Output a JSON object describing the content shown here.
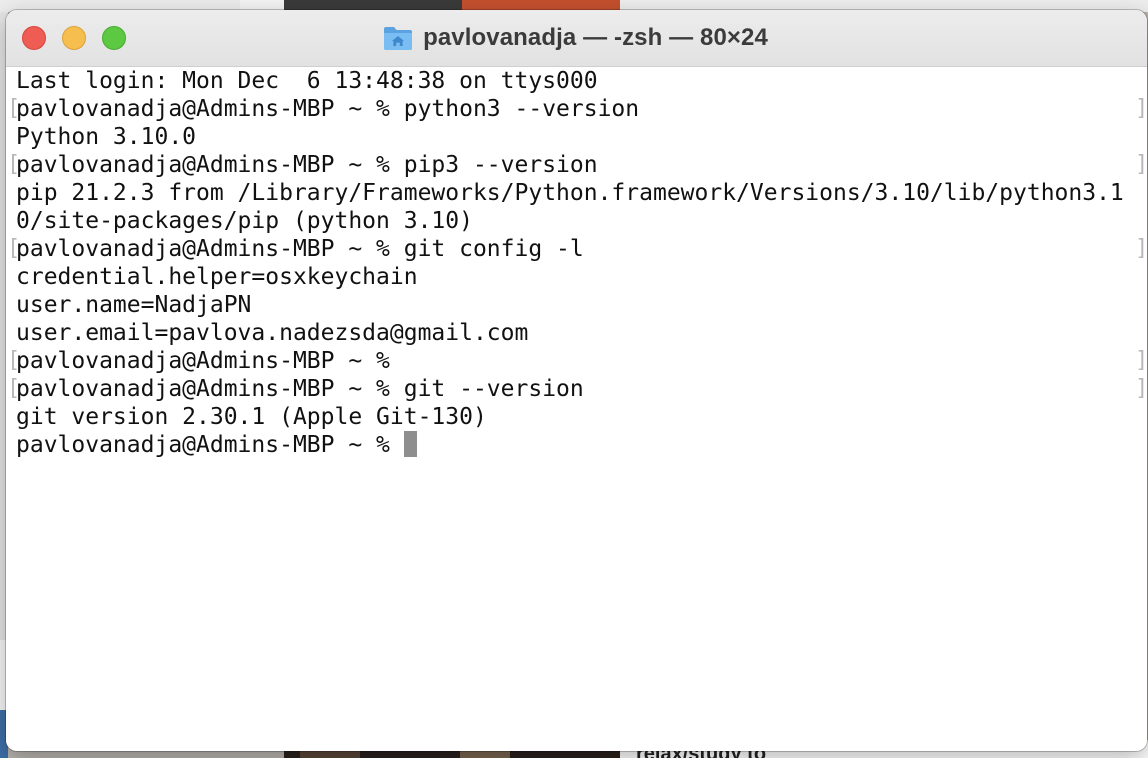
{
  "window": {
    "title": "pavlovanadja — -zsh — 80×24",
    "title_icon": "home-folder-icon"
  },
  "desktop": {
    "partial_text": "relax/study to"
  },
  "terminal": {
    "lines": [
      {
        "text": "Last login: Mon Dec  6 13:48:38 on ttys000",
        "marked": false
      },
      {
        "text": "pavlovanadja@Admins-MBP ~ % python3 --version",
        "marked": true
      },
      {
        "text": "Python 3.10.0",
        "marked": false
      },
      {
        "text": "pavlovanadja@Admins-MBP ~ % pip3 --version",
        "marked": true
      },
      {
        "text": "pip 21.2.3 from /Library/Frameworks/Python.framework/Versions/3.10/lib/python3.1",
        "marked": false
      },
      {
        "text": "0/site-packages/pip (python 3.10)",
        "marked": false
      },
      {
        "text": "pavlovanadja@Admins-MBP ~ % git config -l",
        "marked": true
      },
      {
        "text": "credential.helper=osxkeychain",
        "marked": false
      },
      {
        "text": "user.name=NadjaPN",
        "marked": false
      },
      {
        "text": "user.email=pavlova.nadezsda@gmail.com",
        "marked": false
      },
      {
        "text": "pavlovanadja@Admins-MBP ~ %",
        "marked": true
      },
      {
        "text": "pavlovanadja@Admins-MBP ~ % git --version",
        "marked": true
      },
      {
        "text": "git version 2.30.1 (Apple Git-130)",
        "marked": false
      }
    ],
    "prompt": "pavlovanadja@Admins-MBP ~ % "
  },
  "colors": {
    "close": "#ee5c54",
    "minimize": "#f5be4f",
    "zoom": "#5dc842",
    "text": "#111111",
    "cursor": "#8e8e8e"
  }
}
